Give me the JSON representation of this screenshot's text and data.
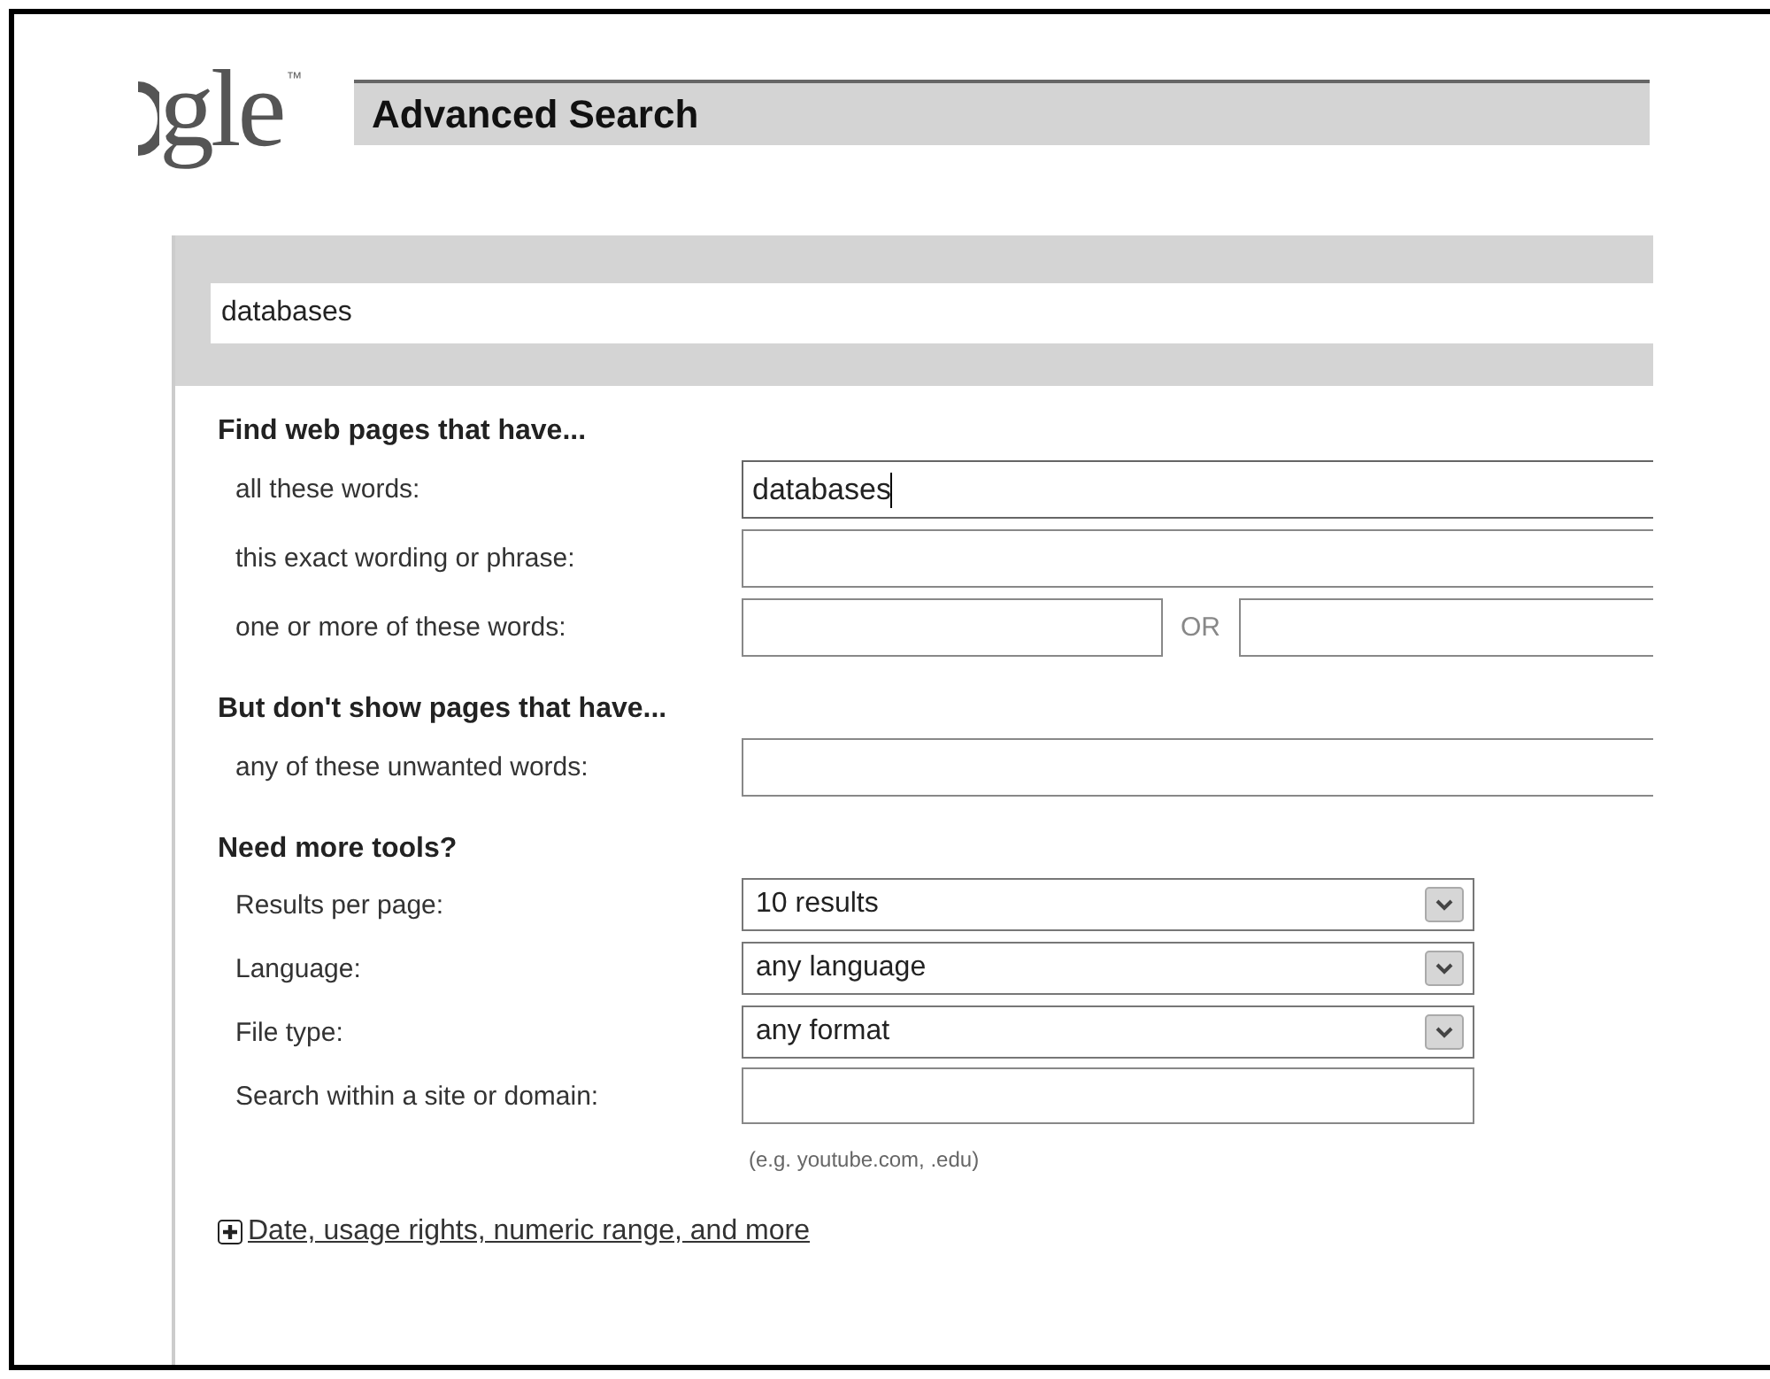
{
  "logo": {
    "text": "gle",
    "mark": "™"
  },
  "title": "Advanced Search",
  "query": "databases",
  "sections": [
    {
      "heading": "Find web pages that have...",
      "kind": "words",
      "rows": [
        {
          "kind": "text",
          "label": "all these words:",
          "value": "databases",
          "focused": true
        },
        {
          "kind": "text",
          "label": "this exact wording or phrase:",
          "focused": false
        },
        {
          "kind": "or",
          "label": "one or more of these words:",
          "joiner": "OR"
        }
      ]
    },
    {
      "heading": "But don't show pages that have...",
      "kind": "words",
      "rows": [
        {
          "kind": "text",
          "label": "any of these unwanted words:",
          "focused": false
        }
      ]
    },
    {
      "heading": "Need more tools?",
      "kind": "tools",
      "rows": [
        {
          "kind": "select",
          "label": "Results per page:",
          "value": "10 results"
        },
        {
          "kind": "select",
          "label": "Language:",
          "value": "any language"
        },
        {
          "kind": "select",
          "label": "File type:",
          "value": "any format"
        },
        {
          "kind": "short",
          "label": "Search within a site or domain:",
          "hint": "(e.g. youtube.com, .edu)"
        }
      ]
    }
  ],
  "more_link": "Date, usage rights, numeric range, and more"
}
